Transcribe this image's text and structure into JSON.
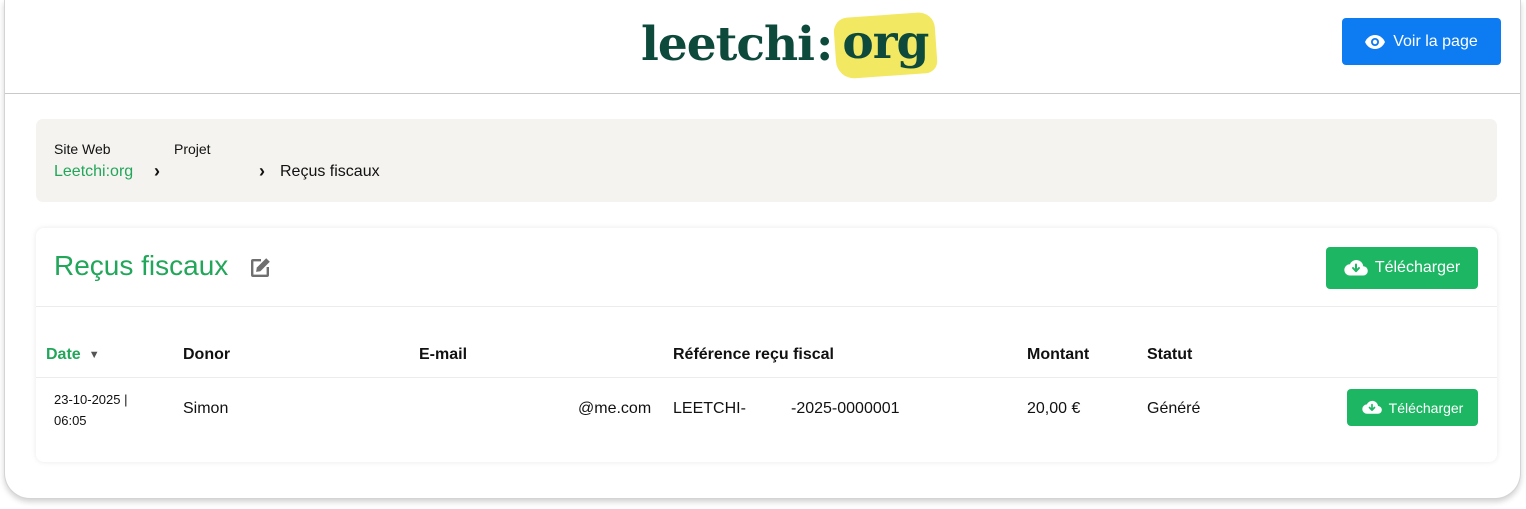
{
  "header": {
    "logo_main": "leetchi",
    "logo_colon": ":",
    "logo_org": "org",
    "voir_label": "Voir la page"
  },
  "breadcrumb": {
    "site_label": "Site Web",
    "site_link": "Leetchi:org",
    "project_label": "Projet",
    "project_link": "",
    "current": "Reçus fiscaux"
  },
  "card": {
    "title": "Reçus fiscaux",
    "download_label": "Télécharger"
  },
  "table": {
    "columns": [
      "Date",
      "Donor",
      "E-mail",
      "Référence reçu fiscal",
      "Montant",
      "Statut"
    ],
    "rows": [
      {
        "date": "23-10-2025 |",
        "time": "06:05",
        "donor": "Simon",
        "email": "@me.com",
        "ref_prefix": "LEETCHI-",
        "ref_suffix": "-2025-0000001",
        "amount": "20,00 €",
        "status": "Généré",
        "download_label": "Télécharger"
      }
    ]
  },
  "colors": {
    "brand_dark": "#0d4a3c",
    "brand_yellow": "#f2e862",
    "green": "#22a65a",
    "button_green": "#1db764",
    "button_blue": "#0d7cf2"
  }
}
